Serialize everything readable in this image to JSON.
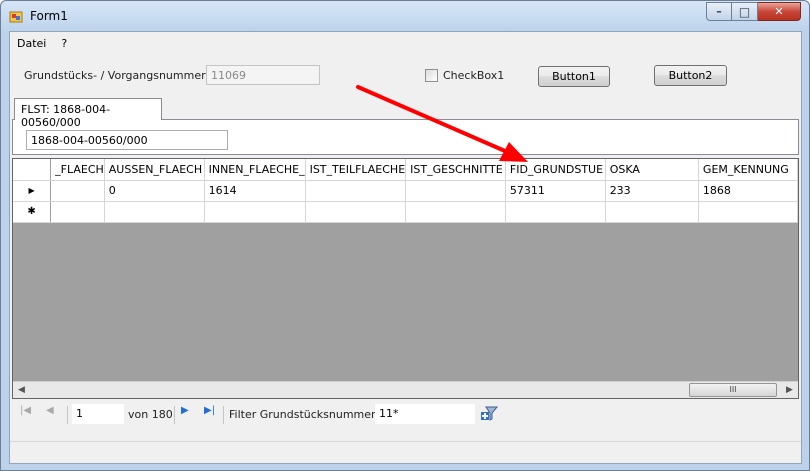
{
  "window": {
    "title": "Form1",
    "minimize_glyph": "–",
    "maximize_glyph": "□",
    "close_glyph": "✕"
  },
  "menu": [
    "Datei",
    "?"
  ],
  "form": {
    "number_label": "Grundstücks- / Vorgangsnummer:",
    "number_value": "11069",
    "checkbox_label": "CheckBox1",
    "button1": "Button1",
    "button2": "Button2"
  },
  "tab": {
    "title": "FLST: 1868-004-00560/000",
    "field_value": "1868-004-00560/000"
  },
  "grid": {
    "columns": [
      "_FLAECH",
      "AUSSEN_FLAECH",
      "INNEN_FLAECHE_",
      "IST_TEILFLAECHE",
      "IST_GESCHNITTE",
      "FID_GRUNDSTUE",
      "OSKA",
      "GEM_KENNUNG"
    ],
    "rows": [
      {
        "marker": "▶",
        "cells": [
          "",
          "0",
          "1614",
          "",
          "",
          "57311",
          "233",
          "1868"
        ]
      },
      {
        "marker": "✱",
        "cells": [
          "",
          "",
          "",
          "",
          "",
          "",
          "",
          ""
        ]
      }
    ],
    "scroll_left_glyph": "◀",
    "scroll_right_glyph": "▶",
    "scroll_thumb_glyph": "III"
  },
  "navigator": {
    "first_glyph": "|◀",
    "prev_glyph": "◀",
    "position": "1",
    "of_label": "von 180",
    "next_glyph": "▶",
    "last_glyph": "▶|",
    "filter_label": "Filter Grundstücksnummer:",
    "filter_value": "11*"
  },
  "colors": {
    "annotation_arrow": "#ff0000",
    "nav_active": "#1f6fd6",
    "nav_disabled": "#a9a9a9"
  }
}
